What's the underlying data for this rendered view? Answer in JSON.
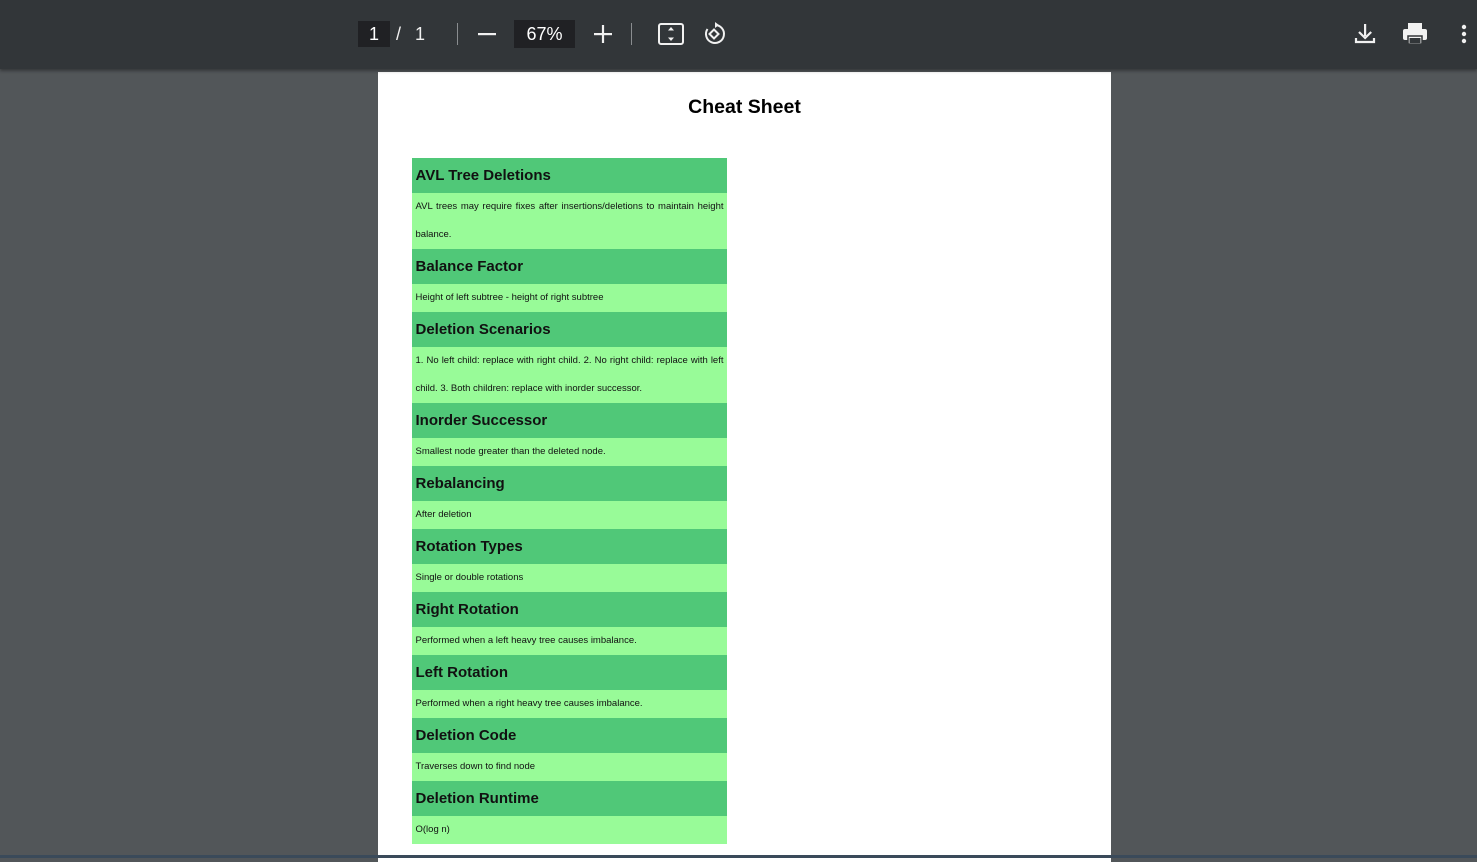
{
  "toolbar": {
    "page_current": "1",
    "page_separator": "/",
    "page_total": "1",
    "zoom": "67%",
    "icons": [
      "minus-icon",
      "plus-icon",
      "fit-page-icon",
      "rotate-icon",
      "download-icon",
      "print-icon",
      "more-vert-icon"
    ]
  },
  "document": {
    "title": "Cheat Sheet",
    "sections": [
      {
        "heading": "AVL Tree Deletions",
        "body": "AVL trees may require fixes after insertions/deletions to maintain height balance."
      },
      {
        "heading": "Balance Factor",
        "body": "Height of left subtree - height of right subtree"
      },
      {
        "heading": "Deletion Scenarios",
        "body": "1. No left child: replace with right child. 2. No right child: replace with left child. 3. Both children: replace with inorder successor."
      },
      {
        "heading": "Inorder Successor",
        "body": "Smallest node greater than the deleted node."
      },
      {
        "heading": "Rebalancing",
        "body": "After deletion"
      },
      {
        "heading": "Rotation Types",
        "body": "Single or double rotations"
      },
      {
        "heading": "Right Rotation",
        "body": "Performed when a left heavy tree causes imbalance."
      },
      {
        "heading": "Left Rotation",
        "body": "Performed when a right heavy tree causes imbalance."
      },
      {
        "heading": "Deletion Code",
        "body": "Traverses down to find node"
      },
      {
        "heading": "Deletion Runtime",
        "body": "O(log n)"
      }
    ]
  },
  "colors": {
    "toolbar_bg": "#323639",
    "viewer_bg": "#525659",
    "section_heading_bg": "#50c878",
    "section_body_bg": "#98fb98"
  }
}
